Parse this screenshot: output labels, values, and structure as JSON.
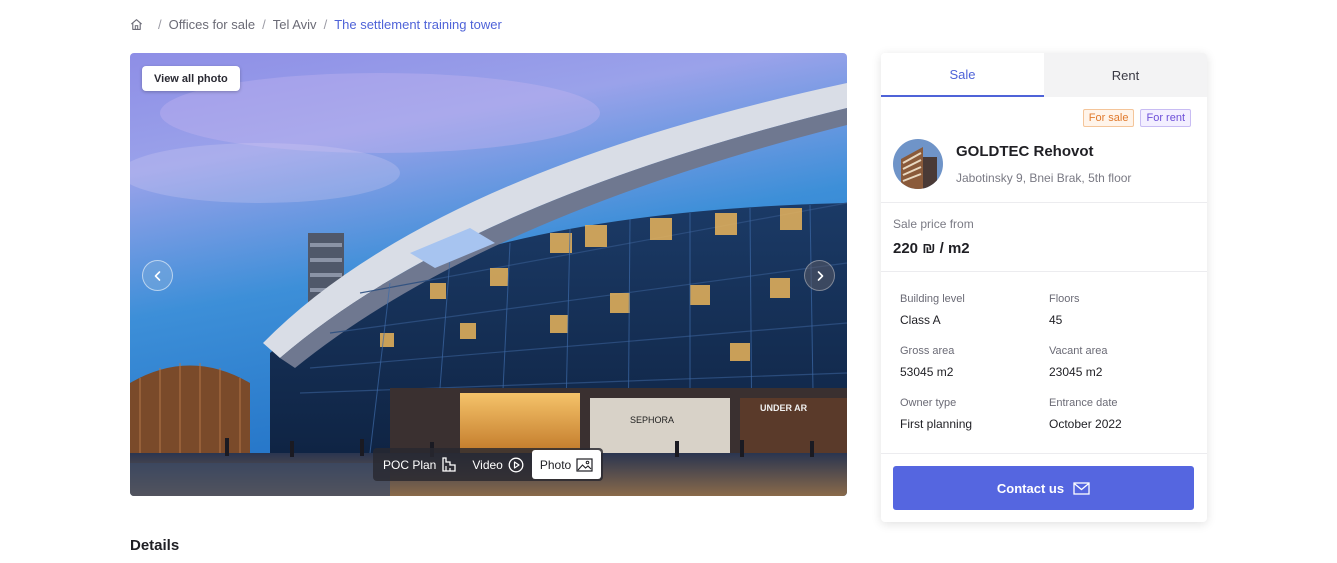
{
  "breadcrumb": {
    "items": [
      "Offices for sale",
      "Tel Aviv"
    ],
    "current": "The settlement training tower"
  },
  "gallery": {
    "view_all_label": "View all photo",
    "tabs": [
      {
        "label": "POC Plan",
        "icon": "floor-plan-icon"
      },
      {
        "label": "Video",
        "icon": "play-circle-icon"
      },
      {
        "label": "Photo",
        "icon": "image-icon"
      }
    ],
    "active_tab": "Photo",
    "storefront_signs": [
      "SEPHORA",
      "UNDER AR"
    ]
  },
  "card": {
    "tabs": [
      {
        "label": "Sale"
      },
      {
        "label": "Rent"
      }
    ],
    "active_tab": "Sale",
    "badges": [
      {
        "label": "For sale"
      },
      {
        "label": "For rent"
      }
    ],
    "company_name": "GOLDTEC Rehovot",
    "company_address": "Jabotinsky 9, Bnei Brak, 5th floor",
    "price_label": "Sale price from",
    "price_value": "220 ₪ / m2",
    "specs": [
      {
        "label": "Building level",
        "value": "Class A"
      },
      {
        "label": "Floors",
        "value": "45"
      },
      {
        "label": "Gross area",
        "value": "53045 m2"
      },
      {
        "label": "Vacant area",
        "value": "23045 m2"
      },
      {
        "label": "Owner type",
        "value": "First planning"
      },
      {
        "label": "Entrance date",
        "value": "October 2022"
      }
    ],
    "contact_label": "Contact us"
  },
  "details_title": "Details",
  "colors": {
    "accent": "#4f63d8",
    "button": "#5566e0",
    "badge_sale": "#e07a2d",
    "badge_rent": "#6d4fd8"
  }
}
